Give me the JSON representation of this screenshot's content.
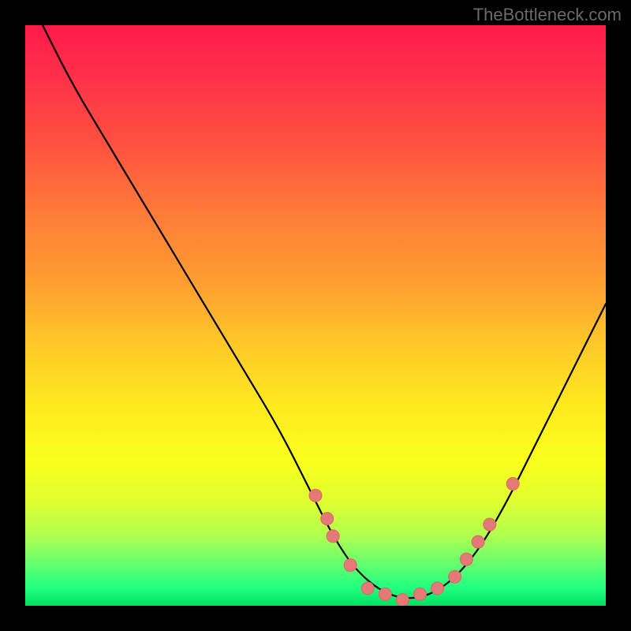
{
  "watermark": "TheBottleneck.com",
  "chart_data": {
    "type": "line",
    "title": "",
    "xlabel": "",
    "ylabel": "",
    "xlim": [
      0,
      100
    ],
    "ylim": [
      0,
      100
    ],
    "curve": [
      {
        "x": 3,
        "y": 100
      },
      {
        "x": 8,
        "y": 90
      },
      {
        "x": 14,
        "y": 80
      },
      {
        "x": 20,
        "y": 70
      },
      {
        "x": 26,
        "y": 60
      },
      {
        "x": 32,
        "y": 50
      },
      {
        "x": 38,
        "y": 40
      },
      {
        "x": 44,
        "y": 30
      },
      {
        "x": 49,
        "y": 20
      },
      {
        "x": 53,
        "y": 12
      },
      {
        "x": 57,
        "y": 6
      },
      {
        "x": 62,
        "y": 2
      },
      {
        "x": 67,
        "y": 1
      },
      {
        "x": 72,
        "y": 3
      },
      {
        "x": 77,
        "y": 8
      },
      {
        "x": 82,
        "y": 16
      },
      {
        "x": 88,
        "y": 28
      },
      {
        "x": 94,
        "y": 40
      },
      {
        "x": 100,
        "y": 52
      }
    ],
    "points": [
      {
        "x": 50,
        "y": 19
      },
      {
        "x": 52,
        "y": 15
      },
      {
        "x": 53,
        "y": 12
      },
      {
        "x": 56,
        "y": 7
      },
      {
        "x": 59,
        "y": 3
      },
      {
        "x": 62,
        "y": 2
      },
      {
        "x": 65,
        "y": 1
      },
      {
        "x": 68,
        "y": 2
      },
      {
        "x": 71,
        "y": 3
      },
      {
        "x": 74,
        "y": 5
      },
      {
        "x": 76,
        "y": 8
      },
      {
        "x": 78,
        "y": 11
      },
      {
        "x": 80,
        "y": 14
      },
      {
        "x": 84,
        "y": 21
      }
    ]
  }
}
